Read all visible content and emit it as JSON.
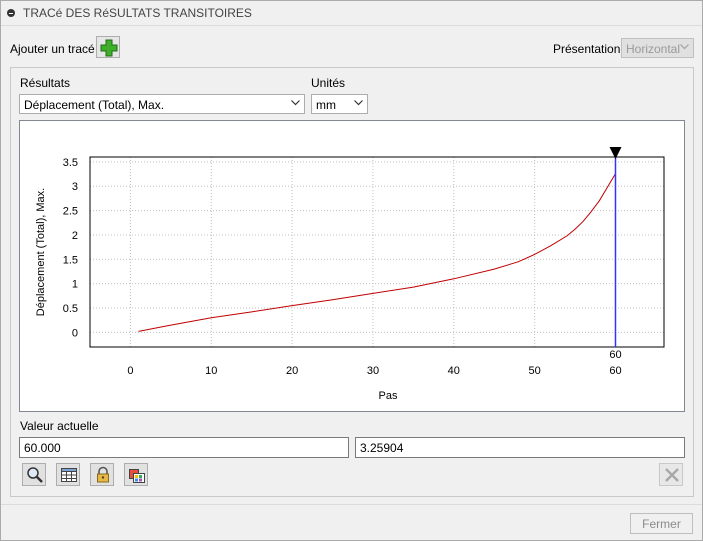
{
  "window": {
    "title": "TRACé DES RéSULTATS TRANSITOIRES"
  },
  "toolbar": {
    "add_plot_label": "Ajouter un tracé",
    "presentation_label": "Présentation",
    "presentation_value": "Horizontal"
  },
  "results": {
    "label": "Résultats",
    "value": "Déplacement (Total), Max."
  },
  "units": {
    "label": "Unités",
    "value": "mm"
  },
  "current_value": {
    "label": "Valeur actuelle",
    "x_value": "60.000",
    "y_value": "3.25904"
  },
  "bottom_toolbar": {
    "icons": [
      "zoom-icon",
      "table-icon",
      "lock-icon",
      "color-palette-icon",
      "delete-icon"
    ]
  },
  "footer": {
    "close_label": "Fermer"
  },
  "colors": {
    "curve": "#c00000",
    "marker": "#3333ff",
    "grid": "#c0c0c0"
  },
  "chart_data": {
    "type": "line",
    "xlabel": "Pas",
    "ylabel": "Déplacement (Total), Max.",
    "xlim": [
      -5,
      66
    ],
    "ylim": [
      -0.3,
      3.6
    ],
    "x_ticks": [
      "0",
      "10",
      "20",
      "30",
      "40",
      "50",
      "60"
    ],
    "y_ticks": [
      "0",
      "0.5",
      "1",
      "1.5",
      "2",
      "2.5",
      "3",
      "3.5"
    ],
    "grid": true,
    "marker": {
      "x": 60,
      "label": "60"
    },
    "series": [
      {
        "x": [
          1,
          5,
          10,
          15,
          20,
          25,
          30,
          35,
          40,
          45,
          48,
          50,
          52,
          54,
          55,
          56,
          57,
          58,
          59,
          60
        ],
        "y": [
          0.02,
          0.15,
          0.3,
          0.42,
          0.55,
          0.67,
          0.8,
          0.93,
          1.1,
          1.3,
          1.45,
          1.6,
          1.78,
          1.98,
          2.12,
          2.28,
          2.48,
          2.7,
          2.98,
          3.26
        ]
      }
    ]
  }
}
